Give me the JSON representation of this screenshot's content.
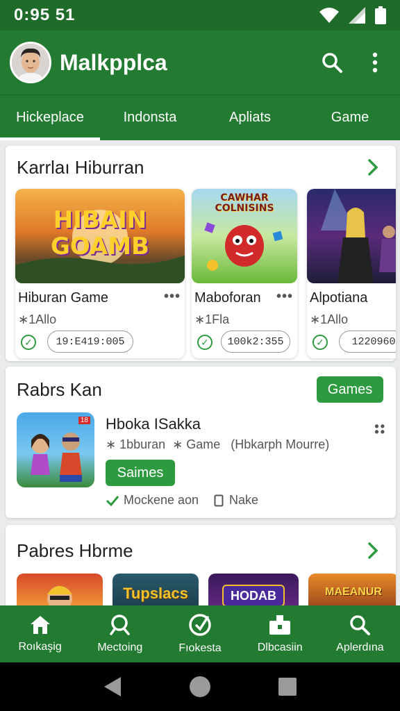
{
  "status_bar": {
    "time": "0:95 51"
  },
  "app_bar": {
    "title": "Malkpplca"
  },
  "tabs": [
    {
      "label": "Hickeplace",
      "active": true
    },
    {
      "label": "Indonsta",
      "active": false
    },
    {
      "label": "Apliats",
      "active": false
    },
    {
      "label": "Game",
      "active": false
    }
  ],
  "section1": {
    "title": "Karrlaı Hiburran",
    "cards": [
      {
        "name": "Hiburan Game",
        "sub": "∗1Allo",
        "code": "19:E419:005",
        "thumb_text": "HIBAIN GOAMB"
      },
      {
        "name": "Maboforan",
        "sub": "∗1Fla",
        "code": "100k2:355",
        "thumb_text": "CAWHAR COLNISINS"
      },
      {
        "name": "Alpotiana",
        "sub": "∗1Allo",
        "code": "1220960",
        "thumb_text": ""
      }
    ]
  },
  "section2": {
    "title": "Rabrs Kan",
    "badge": "Games",
    "app_name": "Hboka ISakka",
    "meta": "∗ 1bburan  ∗ Game   (Hbkarph Mourre)",
    "button": "Saimes",
    "check_label": "Mockene aon",
    "nake_label": "Nake",
    "icon_badge": "18"
  },
  "section3": {
    "title": "Pabres Hbrme",
    "thumbs": [
      "",
      "Tupslacs",
      "HODAB",
      "MAEANUR"
    ]
  },
  "bottom_nav": [
    {
      "label": "Roıkaşig",
      "icon": "home-icon"
    },
    {
      "label": "Mectoing",
      "icon": "search-icon"
    },
    {
      "label": "Fıokesta",
      "icon": "compass-icon"
    },
    {
      "label": "Dlbcasiin",
      "icon": "bag-icon"
    },
    {
      "label": "Aplerdına",
      "icon": "search-icon"
    }
  ],
  "colors": {
    "primary": "#237a31",
    "primary_dark": "#1e6b2a",
    "accent": "#2e9a3f"
  }
}
